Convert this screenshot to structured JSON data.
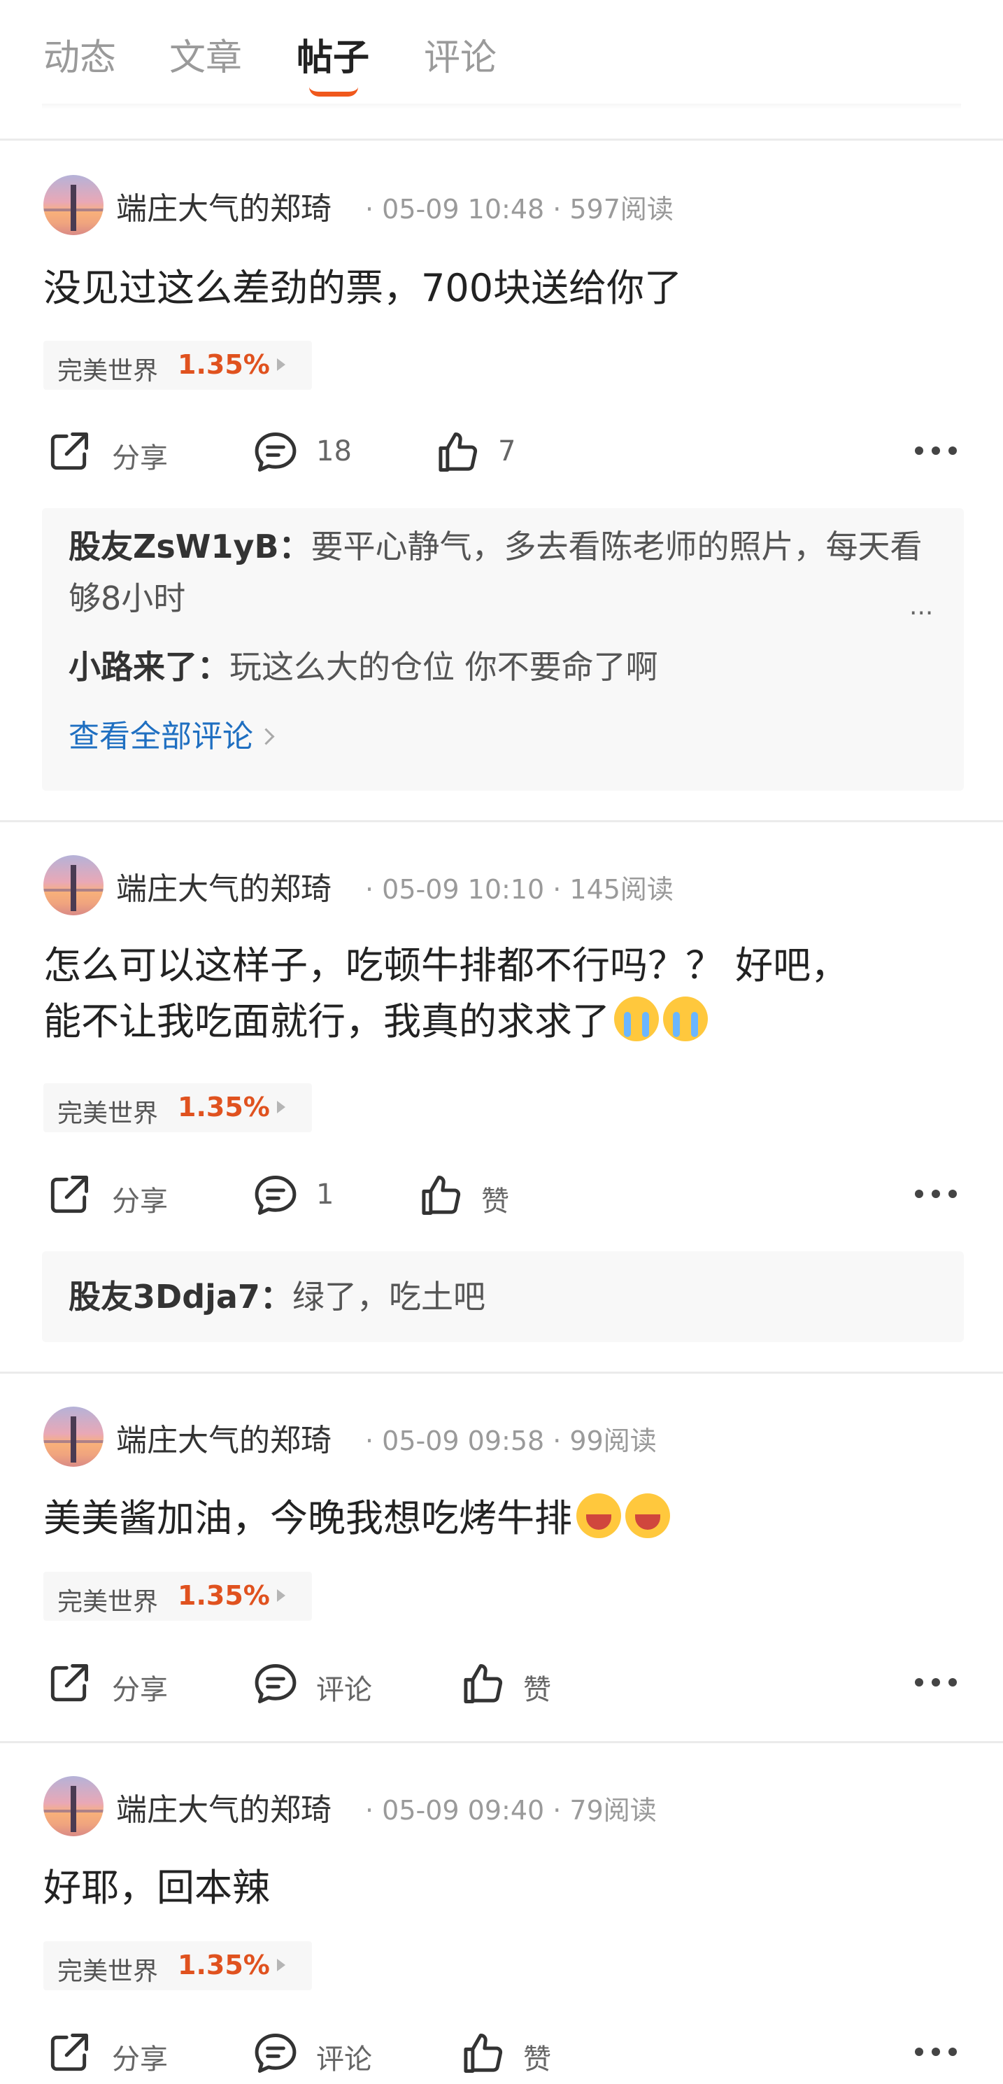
{
  "tabs": [
    {
      "label": "动态",
      "active": false
    },
    {
      "label": "文章",
      "active": false
    },
    {
      "label": "帖子",
      "active": true
    },
    {
      "label": "评论",
      "active": false
    }
  ],
  "colors": {
    "accent": "#f0581c",
    "stock_up": "#e0521f",
    "link": "#1f6fc1"
  },
  "posts": [
    {
      "author": "端庄大气的郑琦",
      "meta": "· 05-09 10:48 · 597阅读",
      "text": "没见过这么差劲的票，700块送给你了",
      "stock": {
        "name": "完美世界",
        "change": "1.35%"
      },
      "actions": {
        "share": "分享",
        "comment": "18",
        "like": "7"
      },
      "comments": [
        {
          "user": "股友ZsW1yB：",
          "text": "要平心静气，多去看陈老师的照片，每天看够8小时",
          "more": "..."
        },
        {
          "user": "小路来了：",
          "text": "玩这么大的仓位 你不要命了啊"
        }
      ],
      "view_all": "查看全部评论"
    },
    {
      "author": "端庄大气的郑琦",
      "meta": "· 05-09 10:10 · 145阅读",
      "text_line1": "怎么可以这样子，吃顿牛排都不行吗？？ 好吧，",
      "text_line2": "能不让我吃面就行，我真的求求了",
      "emoji": "loudly-crying-face",
      "stock": {
        "name": "完美世界",
        "change": "1.35%"
      },
      "actions": {
        "share": "分享",
        "comment": "1",
        "like": "赞"
      },
      "comments": [
        {
          "user": "股友3Ddja7：",
          "text": "绿了，吃土吧"
        }
      ]
    },
    {
      "author": "端庄大气的郑琦",
      "meta": "· 05-09 09:58 · 99阅读",
      "text": "美美酱加油，今晚我想吃烤牛排",
      "emoji": "grinning-face",
      "stock": {
        "name": "完美世界",
        "change": "1.35%"
      },
      "actions": {
        "share": "分享",
        "comment": "评论",
        "like": "赞"
      }
    },
    {
      "author": "端庄大气的郑琦",
      "meta": "· 05-09 09:40 · 79阅读",
      "text": "好耶，回本辣",
      "stock": {
        "name": "完美世界",
        "change": "1.35%"
      },
      "actions": {
        "share": "分享",
        "comment": "评论",
        "like": "赞"
      }
    }
  ]
}
